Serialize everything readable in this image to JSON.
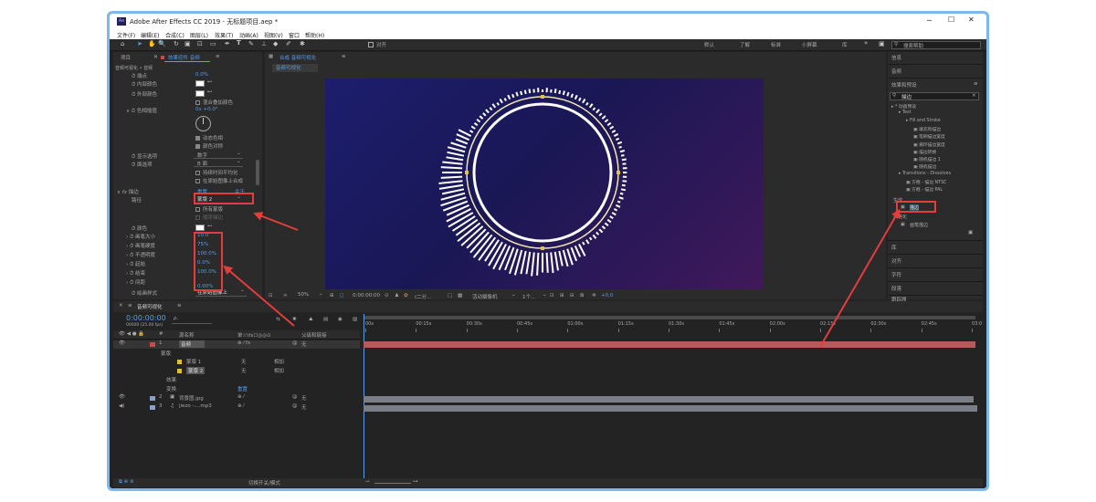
{
  "window": {
    "title": "Adobe After Effects CC 2019 - 无标题项目.aep *",
    "app_badge": "Ae",
    "min": "─",
    "max": "☐",
    "close": "✕"
  },
  "menu": [
    "文件(F)",
    "编辑(E)",
    "合成(C)",
    "图层(L)",
    "效果(T)",
    "动画(A)",
    "视图(V)",
    "窗口",
    "帮助(H)"
  ],
  "toolbar": {
    "snap_label": "对齐",
    "workspaces": [
      "默认",
      "了解",
      "标准",
      "小屏幕",
      "库"
    ],
    "search_placeholder": "搜索帮助"
  },
  "left_panel": {
    "tabs": [
      "项目",
      "效果控件 音频"
    ],
    "breadcrumb": "音频可视化 • 音频",
    "props": [
      {
        "label": "端点",
        "value": "0.0%"
      },
      {
        "label": "内部颜色",
        "value": ""
      },
      {
        "label": "外部颜色",
        "value": ""
      },
      {
        "label": "",
        "value": "混合叠加颜色"
      },
      {
        "label": "色相插值",
        "value": "0x +0.0°"
      },
      {
        "label": "",
        "value": "动态色相"
      },
      {
        "label": "",
        "value": "颜色对称"
      },
      {
        "label": "显示选项",
        "value": "数字"
      },
      {
        "label": "面选项",
        "value": "B 面"
      },
      {
        "label": "",
        "value": "持续时间平均化"
      },
      {
        "label": "",
        "value": "在原始图像上合成"
      }
    ],
    "fx_name": "描边",
    "fx_reset": "重置",
    "fx_about": "关于",
    "path_label": "路径",
    "path_value": "蒙版 2",
    "all_masks": "所有蒙版",
    "sequential": "顺序描边",
    "color_label": "颜色",
    "stroke_props": [
      {
        "label": "画笔大小",
        "value": "10.0"
      },
      {
        "label": "画笔硬度",
        "value": "75%"
      },
      {
        "label": "不透明度",
        "value": "100.0%"
      },
      {
        "label": "起始",
        "value": "0.0%"
      },
      {
        "label": "结束",
        "value": "100.0%"
      },
      {
        "label": "间距",
        "value": "0.00%"
      }
    ],
    "paint_style_label": "绘画样式",
    "paint_style_value": "在原始图像上"
  },
  "comp": {
    "tab": "合成 音频可视化",
    "sub_tab": "音频可视化",
    "zoom": "50%",
    "timecode": "0:00:00:00",
    "resolution": "(二分...",
    "camera": "活动摄像机",
    "views": "1个...",
    "exposure": "+0.0"
  },
  "right_panel": {
    "items": [
      "信息",
      "音频",
      "效果和预设"
    ],
    "search_value": "描边",
    "tree": [
      {
        "label": "* 动画预设",
        "depth": 0
      },
      {
        "label": "Text",
        "depth": 1
      },
      {
        "label": "Fill and Stroke",
        "depth": 2
      },
      {
        "label": "填充和描边",
        "depth": 3
      },
      {
        "label": "笔刷描边宽度",
        "depth": 3
      },
      {
        "label": "循环描边宽度",
        "depth": 3
      },
      {
        "label": "描边转换",
        "depth": 3
      },
      {
        "label": "随机描边 1",
        "depth": 3
      },
      {
        "label": "随机描边",
        "depth": 3
      },
      {
        "label": "Transitions - Dissolves",
        "depth": 1
      },
      {
        "label": "方框 - 描边 NTSC",
        "depth": 2
      },
      {
        "label": "方框 - 描边 PAL",
        "depth": 2
      }
    ],
    "group1": "生成",
    "group1_item": "描边",
    "group2": "风格化",
    "group2_item": "画笔描边",
    "bottom_items": [
      "库",
      "对齐",
      "字符",
      "段落",
      "跟踪器"
    ]
  },
  "timeline": {
    "tab": "音频可视化",
    "timecode": "0:00:00:00",
    "fps": "00000 (25.00 fps)",
    "search_placeholder": "",
    "col_source": "源名称",
    "col_switches": "单☆\\fx☐◎◎⊙",
    "col_parent": "父级和链接",
    "ruler": [
      "00s",
      "00:15s",
      "00:30s",
      "00:45s",
      "01:00s",
      "01:15s",
      "01:30s",
      "01:45s",
      "02:00s",
      "02:15s",
      "02:30s",
      "02:45s",
      "03:0"
    ],
    "layers": [
      {
        "num": "1",
        "name": "音频",
        "parent": "无",
        "color": "#c94a4a"
      },
      {
        "num": "",
        "name": "蒙版",
        "parent": "",
        "color": ""
      },
      {
        "num": "",
        "name": "蒙版 1",
        "parent": "相加",
        "mode": "无",
        "color": "#e0c030"
      },
      {
        "num": "",
        "name": "蒙版 2",
        "parent": "相加",
        "mode": "无",
        "color": "#e0c030"
      },
      {
        "num": "",
        "name": "效果",
        "parent": "",
        "color": ""
      },
      {
        "num": "",
        "name": "变换",
        "parent": "重置",
        "color": ""
      },
      {
        "num": "2",
        "name": "背景图.jpg",
        "parent": "无",
        "color": "#8aa0c8"
      },
      {
        "num": "3",
        "name": "jiezo -....mp3",
        "parent": "无",
        "color": "#8aa0c8"
      }
    ],
    "footer": "切换开关/模式"
  },
  "colors": {
    "accent": "#5a9de8",
    "highlight_red": "#e53c3c",
    "track_red": "#b65a5a",
    "track_gray": "#7a7f87"
  }
}
